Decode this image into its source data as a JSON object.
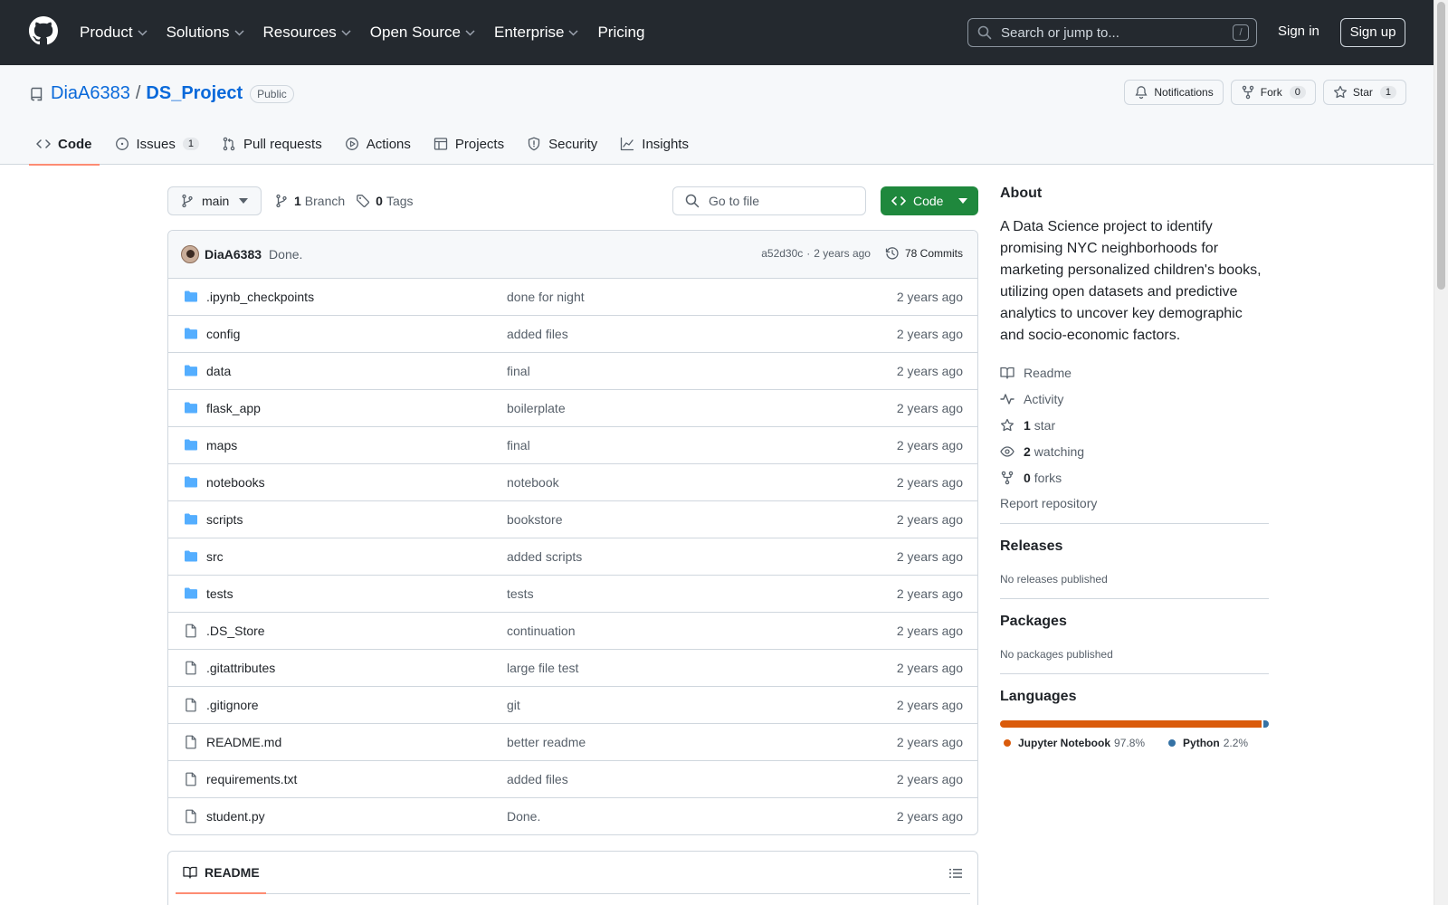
{
  "header": {
    "nav": [
      {
        "label": "Product",
        "has_menu": true
      },
      {
        "label": "Solutions",
        "has_menu": true
      },
      {
        "label": "Resources",
        "has_menu": true
      },
      {
        "label": "Open Source",
        "has_menu": true
      },
      {
        "label": "Enterprise",
        "has_menu": true
      },
      {
        "label": "Pricing",
        "has_menu": false
      }
    ],
    "search_placeholder": "Search or jump to...",
    "search_shortcut": "/",
    "sign_in": "Sign in",
    "sign_up": "Sign up"
  },
  "repo": {
    "owner": "DiaA6383",
    "separator": "/",
    "name": "DS_Project",
    "visibility": "Public",
    "actions": {
      "notifications": "Notifications",
      "fork": "Fork",
      "fork_count": "0",
      "star": "Star",
      "star_count": "1"
    },
    "tabs": [
      {
        "label": "Code",
        "icon": "code-icon",
        "active": true,
        "count": ""
      },
      {
        "label": "Issues",
        "icon": "issue-icon",
        "active": false,
        "count": "1"
      },
      {
        "label": "Pull requests",
        "icon": "pull-request-icon",
        "active": false,
        "count": ""
      },
      {
        "label": "Actions",
        "icon": "play-icon",
        "active": false,
        "count": ""
      },
      {
        "label": "Projects",
        "icon": "table-icon",
        "active": false,
        "count": ""
      },
      {
        "label": "Security",
        "icon": "shield-icon",
        "active": false,
        "count": ""
      },
      {
        "label": "Insights",
        "icon": "graph-icon",
        "active": false,
        "count": ""
      }
    ]
  },
  "files": {
    "branch": "main",
    "branch_count": "1",
    "branch_label": "Branch",
    "tag_count": "0",
    "tag_label": "Tags",
    "goto_placeholder": "Go to file",
    "code_button": "Code",
    "latest_commit": {
      "author": "DiaA6383",
      "message": "Done.",
      "hash": "a52d30c",
      "dot": "·",
      "age": "2 years ago",
      "commits": "78 Commits"
    },
    "rows": [
      {
        "type": "folder",
        "name": ".ipynb_checkpoints",
        "commit": "done for night",
        "age": "2 years ago"
      },
      {
        "type": "folder",
        "name": "config",
        "commit": "added files",
        "age": "2 years ago"
      },
      {
        "type": "folder",
        "name": "data",
        "commit": "final",
        "age": "2 years ago"
      },
      {
        "type": "folder",
        "name": "flask_app",
        "commit": "boilerplate",
        "age": "2 years ago"
      },
      {
        "type": "folder",
        "name": "maps",
        "commit": "final",
        "age": "2 years ago"
      },
      {
        "type": "folder",
        "name": "notebooks",
        "commit": "notebook",
        "age": "2 years ago"
      },
      {
        "type": "folder",
        "name": "scripts",
        "commit": "bookstore",
        "age": "2 years ago"
      },
      {
        "type": "folder",
        "name": "src",
        "commit": "added scripts",
        "age": "2 years ago"
      },
      {
        "type": "folder",
        "name": "tests",
        "commit": "tests",
        "age": "2 years ago"
      },
      {
        "type": "file",
        "name": ".DS_Store",
        "commit": "continuation",
        "age": "2 years ago"
      },
      {
        "type": "file",
        "name": ".gitattributes",
        "commit": "large file test",
        "age": "2 years ago"
      },
      {
        "type": "file",
        "name": ".gitignore",
        "commit": "git",
        "age": "2 years ago"
      },
      {
        "type": "file",
        "name": "README.md",
        "commit": "better readme",
        "age": "2 years ago"
      },
      {
        "type": "file",
        "name": "requirements.txt",
        "commit": "added files",
        "age": "2 years ago"
      },
      {
        "type": "file",
        "name": "student.py",
        "commit": "Done.",
        "age": "2 years ago"
      }
    ],
    "readme_tab": "README"
  },
  "sidebar": {
    "about_title": "About",
    "description": "A Data Science project to identify promising NYC neighborhoods for marketing personalized children's books, utilizing open datasets and predictive analytics to uncover key demographic and socio-economic factors.",
    "links": {
      "readme": "Readme",
      "activity": "Activity",
      "stars_count": "1",
      "stars_label": "star",
      "watching_count": "2",
      "watching_label": "watching",
      "forks_count": "0",
      "forks_label": "forks"
    },
    "report": "Report repository",
    "releases_title": "Releases",
    "releases_text": "No releases published",
    "packages_title": "Packages",
    "packages_text": "No packages published",
    "languages_title": "Languages",
    "languages": [
      {
        "name": "Jupyter Notebook",
        "percent": "97.8%",
        "value": 97.8,
        "color": "#da5b0b"
      },
      {
        "name": "Python",
        "percent": "2.2%",
        "value": 2.2,
        "color": "#3572a5"
      }
    ]
  },
  "colors": {
    "header_bg": "#24292f",
    "link": "#0969da",
    "primary_green": "#1f883d",
    "tab_underline": "#fd8c73",
    "folder_icon": "#54aeff"
  }
}
